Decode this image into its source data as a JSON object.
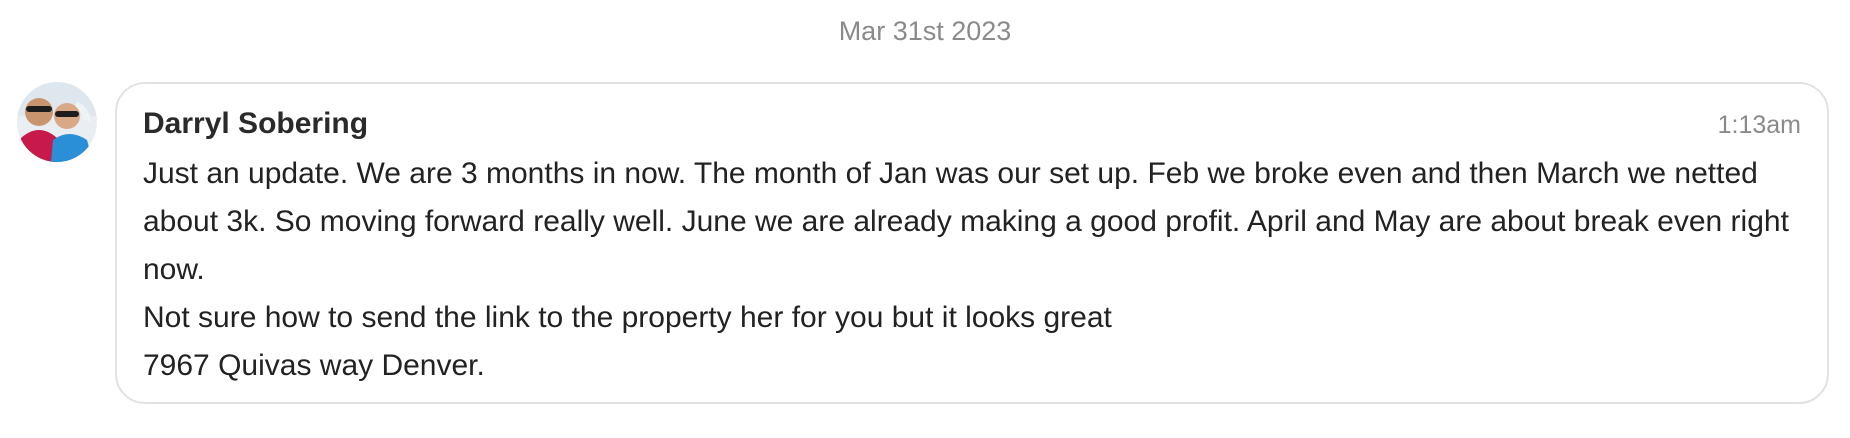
{
  "conversation": {
    "date_separator": "Mar 31st 2023"
  },
  "message": {
    "author": "Darryl Sobering",
    "time": "1:13am",
    "avatar_icon": "user-avatar-photo",
    "paragraphs": [
      "Just an update. We are 3 months in now. The month of Jan was our set up. Feb we broke even and then March we netted about 3k. So moving forward really well. June we are already making a good profit. April and May are about break even right now.",
      "Not sure how to send the link to the property her for you but it looks great",
      "7967 Quivas way Denver."
    ]
  },
  "colors": {
    "card_border": "#e2e2e2",
    "muted_text": "#8a8a8a",
    "body_text": "#222222"
  }
}
